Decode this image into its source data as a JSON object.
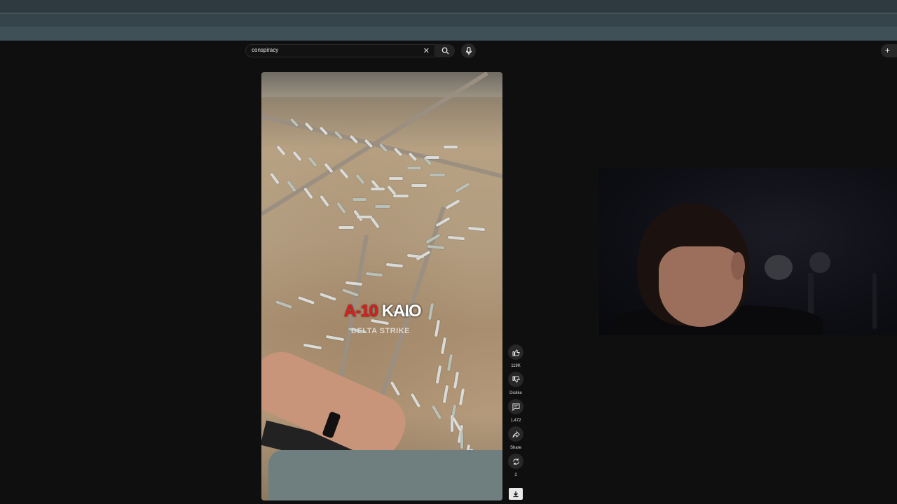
{
  "search": {
    "query": "conspiracy"
  },
  "icons": {
    "clear": "close-icon",
    "search": "search-icon",
    "mic": "microphone-icon",
    "create": "plus-icon",
    "like": "thumbs-up-icon",
    "dislike": "thumbs-down-icon",
    "comments": "comment-icon",
    "share": "share-icon",
    "remix": "remix-icon",
    "download": "download-icon"
  },
  "video": {
    "overlay_title_part1": "A-10",
    "overlay_title_part2": "KAIO",
    "overlay_subtitle": "DELTA STRIKE"
  },
  "actions": {
    "likes": "119K",
    "dislike_label": "Dislike",
    "comments": "1,472",
    "share_label": "Share",
    "remix_count": "2"
  },
  "colors": {
    "page_bg": "#0f0f0f",
    "title_red": "#e01c1c",
    "chrome_bg": "#2e3a40"
  }
}
